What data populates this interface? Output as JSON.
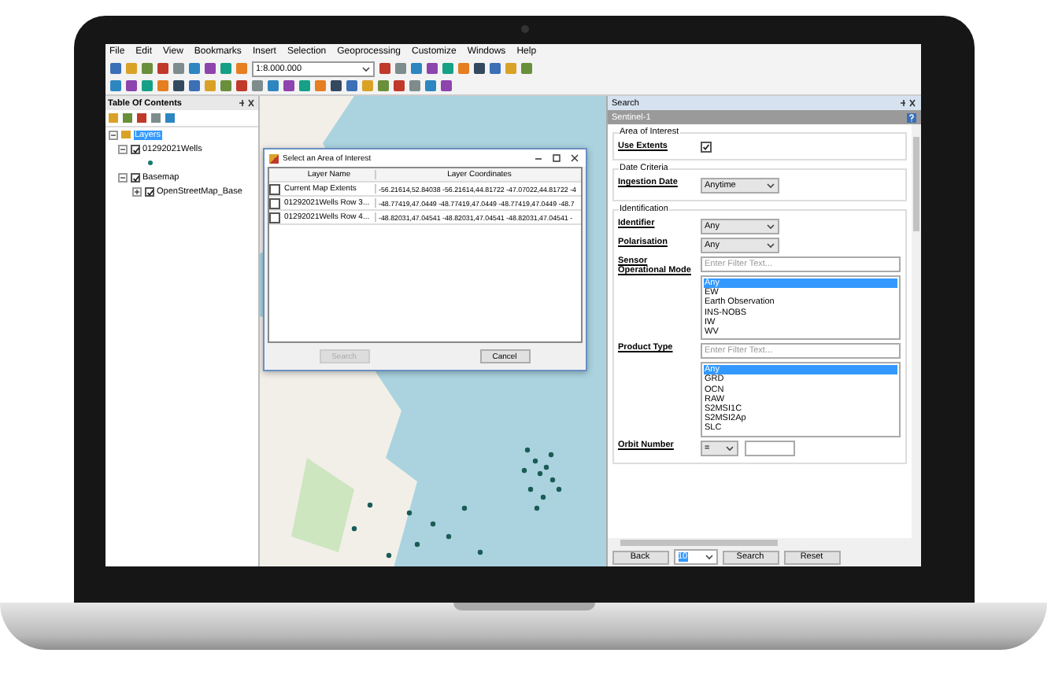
{
  "menu": [
    "File",
    "Edit",
    "View",
    "Bookmarks",
    "Insert",
    "Selection",
    "Geoprocessing",
    "Customize",
    "Windows",
    "Help"
  ],
  "toolbar": {
    "scale": "1:8.000.000"
  },
  "toc": {
    "title": "Table Of Contents",
    "root": {
      "label": "Layers",
      "selected": true
    },
    "layers": [
      {
        "label": "01292021Wells",
        "checked": true,
        "expanded": true
      },
      {
        "label": "Basemap",
        "checked": true,
        "expanded": true,
        "children": [
          {
            "label": "OpenStreetMap_Base",
            "checked": true,
            "expanded": false
          }
        ]
      }
    ]
  },
  "dialog": {
    "title": "Select an Area of Interest",
    "columns": [
      "Layer Name",
      "Layer Coordinates"
    ],
    "rows": [
      {
        "checked": false,
        "name": "Current Map Extents",
        "coords": "-56.21614,52.84038 -56.21614,44.81722 -47.07022,44.81722 -4"
      },
      {
        "checked": false,
        "name": "01292021Wells Row 3...",
        "coords": "-48.77419,47.0449 -48.77419,47.0449 -48.77419,47.0449 -48.7"
      },
      {
        "checked": false,
        "name": "01292021Wells Row 4...",
        "coords": "-48.82031,47.04541 -48.82031,47.04541 -48.82031,47.04541 -"
      }
    ],
    "buttons": [
      {
        "label": "Search",
        "disabled": true
      },
      {
        "label": "Cancel",
        "disabled": false
      }
    ]
  },
  "search": {
    "title": "Search",
    "subtitle": "Sentinel-1",
    "groups": [
      {
        "title": "Area of Interest",
        "fields": [
          {
            "kind": "checkbox",
            "label": "Use Extents",
            "checked": true
          }
        ]
      },
      {
        "title": "Date Criteria",
        "fields": [
          {
            "kind": "dropdown",
            "label": "Ingestion Date",
            "value": "Anytime"
          }
        ]
      },
      {
        "title": "Identification",
        "fields": [
          {
            "kind": "dropdown",
            "label": "Identifier",
            "value": "Any"
          },
          {
            "kind": "dropdown",
            "label": "Polarisation",
            "value": "Any"
          },
          {
            "kind": "list",
            "label": "Sensor Operational Mode",
            "placeholder": "Enter Filter Text...",
            "items": [
              {
                "label": "Any",
                "selected": true
              },
              {
                "label": "EW",
                "selected": false
              },
              {
                "label": "Earth Observation",
                "selected": false
              },
              {
                "label": "INS-NOBS",
                "selected": false
              },
              {
                "label": "IW",
                "selected": false
              },
              {
                "label": "WV",
                "selected": false
              }
            ]
          },
          {
            "kind": "list",
            "label": "Product Type",
            "placeholder": "Enter Filter Text...",
            "items": [
              {
                "label": "Any",
                "selected": true
              },
              {
                "label": "GRD",
                "selected": false
              },
              {
                "label": "OCN",
                "selected": false
              },
              {
                "label": "RAW",
                "selected": false
              },
              {
                "label": "S2MSI1C",
                "selected": false
              },
              {
                "label": "S2MSI2Ap",
                "selected": false
              },
              {
                "label": "SLC",
                "selected": false
              }
            ]
          },
          {
            "kind": "operator",
            "label": "Orbit Number",
            "value": "="
          }
        ]
      }
    ],
    "footer": {
      "back": "Back",
      "page_size": "10",
      "search": "Search",
      "reset": "Reset"
    }
  }
}
